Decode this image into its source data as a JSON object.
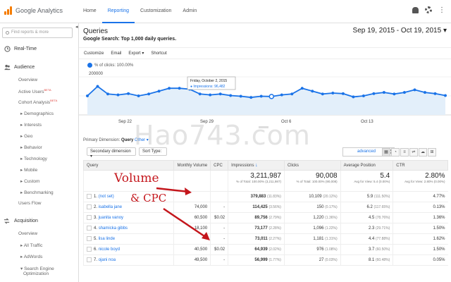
{
  "app": {
    "name": "Google Analytics"
  },
  "top_nav": [
    "Home",
    "Reporting",
    "Customization",
    "Admin"
  ],
  "sidebar": {
    "search_placeholder": "Find reports & more",
    "items": [
      {
        "label": "Real-Time",
        "kind": "head"
      },
      {
        "label": "Audience",
        "kind": "head"
      },
      {
        "label": "Overview",
        "kind": "sub"
      },
      {
        "label": "Active Users",
        "kind": "sub",
        "badge": "BETA"
      },
      {
        "label": "Cohort Analysis",
        "kind": "sub",
        "badge": "BETA"
      },
      {
        "label": "▸ Demographics",
        "kind": "sub"
      },
      {
        "label": "▸ Interests",
        "kind": "sub"
      },
      {
        "label": "▸ Geo",
        "kind": "sub"
      },
      {
        "label": "▸ Behavior",
        "kind": "sub"
      },
      {
        "label": "▸ Technology",
        "kind": "sub"
      },
      {
        "label": "▸ Mobile",
        "kind": "sub"
      },
      {
        "label": "▸ Custom",
        "kind": "sub"
      },
      {
        "label": "▸ Benchmarking",
        "kind": "sub"
      },
      {
        "label": "Users Flow",
        "kind": "sub"
      },
      {
        "label": "Acquisition",
        "kind": "head"
      },
      {
        "label": "Overview",
        "kind": "sub"
      },
      {
        "label": "▸ All Traffic",
        "kind": "sub"
      },
      {
        "label": "▸ AdWords",
        "kind": "sub"
      },
      {
        "label": "▾ Search Engine",
        "kind": "sub"
      },
      {
        "label": "Optimization",
        "kind": "sub"
      }
    ]
  },
  "header": {
    "title": "Queries",
    "subtitle": "Google Search: Top 1,000 daily queries.",
    "date_range": "Sep 19, 2015 - Oct 19, 2015"
  },
  "toolbar": [
    "Customize",
    "Email",
    "Export ▾",
    "Shortcut"
  ],
  "chart": {
    "legend": "% of clicks: 100.00%",
    "tooltip_date": "Friday, October 2, 2015",
    "tooltip_value": "● Impressions: 96,482"
  },
  "chart_data": {
    "type": "line",
    "series": [
      {
        "name": "Impressions",
        "values": [
          100000,
          150000,
          110000,
          105000,
          112000,
          100000,
          110000,
          125000,
          140000,
          140000,
          135000,
          110000,
          105000,
          110000,
          102000,
          98000,
          92000,
          98000,
          96482,
          105000,
          110000,
          140000,
          125000,
          110000,
          115000,
          112000,
          95000,
          100000,
          112000,
          118000,
          110000,
          118000,
          132000,
          118000,
          112000,
          102000
        ]
      }
    ],
    "y_ticks": [
      "200000",
      "100000"
    ],
    "x_ticks": [
      "Sep 22",
      "Sep 29",
      "Oct 6",
      "Oct 13"
    ],
    "ylim": [
      0,
      200000
    ],
    "color": "#1a73e8"
  },
  "dimension": {
    "label": "Primary Dimension:",
    "active": "Query",
    "other": "Other ▾",
    "secondary": "Secondary dimension ▾",
    "sort": "Sort Type:",
    "advanced": "advanced"
  },
  "table": {
    "columns": [
      "Query",
      "Monthly Volume",
      "CPC",
      "Impressions",
      "Clicks",
      "Average Position",
      "CTR"
    ],
    "totals": {
      "impressions": "3,211,987",
      "impressions_sub": "% of Total: 100.00% (3,211,987)",
      "clicks": "90,008",
      "clicks_sub": "% of Total: 100.00% (90,008)",
      "position": "5.4",
      "position_sub": "Avg for View: 5.4 (0.00%)",
      "ctr": "2.80%",
      "ctr_sub": "Avg for View: 2.80% (0.00%)"
    },
    "rows": [
      {
        "n": "1.",
        "query": "(not set)",
        "volume": "",
        "cpc": "",
        "impr": "379,883",
        "impr_pct": "(11.83%)",
        "clicks": "10,109",
        "clicks_pct": "(20.12%)",
        "pos": "5.9",
        "pos_pct": "(111.50%)",
        "ctr": "4.77%"
      },
      {
        "n": "2.",
        "query": "isabella jane",
        "volume": "74,000",
        "cpc": "-",
        "impr": "114,425",
        "impr_pct": "(3.56%)",
        "clicks": "150",
        "clicks_pct": "(0.17%)",
        "pos": "6.2",
        "pos_pct": "(117.65%)",
        "ctr": "0.13%"
      },
      {
        "n": "3.",
        "query": "juanita vanoy",
        "volume": "60,500",
        "cpc": "$0.02",
        "impr": "89,756",
        "impr_pct": "(2.79%)",
        "clicks": "1,220",
        "clicks_pct": "(1.36%)",
        "pos": "4.5",
        "pos_pct": "(78.76%)",
        "ctr": "1.36%"
      },
      {
        "n": "4.",
        "query": "shamicka gibbs",
        "volume": "18,100",
        "cpc": "-",
        "impr": "73,177",
        "impr_pct": "(2.28%)",
        "clicks": "1,096",
        "clicks_pct": "(1.22%)",
        "pos": "2.3",
        "pos_pct": "(29.71%)",
        "ctr": "1.50%"
      },
      {
        "n": "5.",
        "query": "lisa linde",
        "volume": "",
        "cpc": "-",
        "impr": "73,011",
        "impr_pct": "(2.27%)",
        "clicks": "1,181",
        "clicks_pct": "(1.31%)",
        "pos": "4.4",
        "pos_pct": "(77.88%)",
        "ctr": "1.62%"
      },
      {
        "n": "6.",
        "query": "nicole boyd",
        "volume": "40,500",
        "cpc": "$0.02",
        "impr": "64,939",
        "impr_pct": "(2.02%)",
        "clicks": "976",
        "clicks_pct": "(1.08%)",
        "pos": "3.7",
        "pos_pct": "(60.50%)",
        "ctr": "1.50%"
      },
      {
        "n": "7.",
        "query": "ojani noa",
        "volume": "49,500",
        "cpc": "-",
        "impr": "56,999",
        "impr_pct": "(1.77%)",
        "clicks": "27",
        "clicks_pct": "(0.03%)",
        "pos": "8.1",
        "pos_pct": "(60.48%)",
        "ctr": "0.05%"
      }
    ]
  },
  "annotations": {
    "line1": "Volume",
    "line2": "& CPC"
  },
  "watermark": "Hao743.com"
}
